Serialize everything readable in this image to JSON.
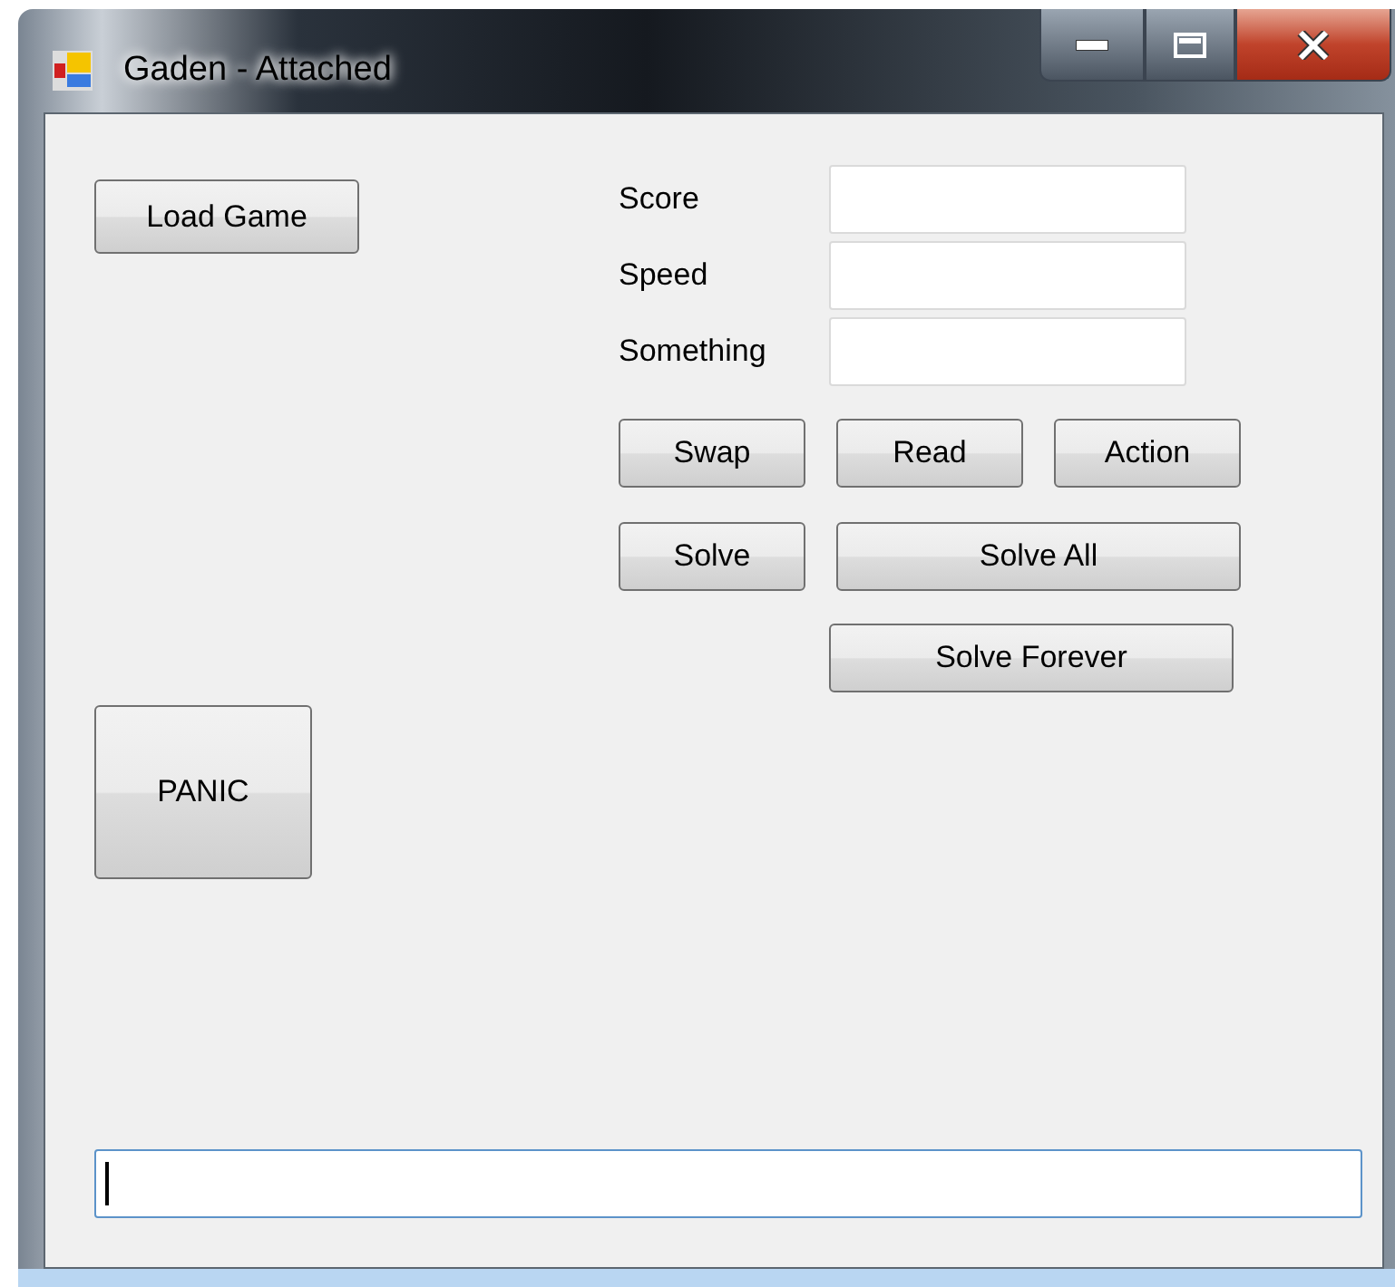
{
  "window": {
    "title": "Gaden - Attached"
  },
  "load_button": "Load Game",
  "fields": [
    {
      "label": "Score"
    },
    {
      "label": "Speed"
    },
    {
      "label": "Something"
    }
  ],
  "button_rows": [
    {
      "buttons": [
        {
          "label": "Swap"
        },
        {
          "label": "Read"
        },
        {
          "label": "Action"
        }
      ]
    },
    {
      "buttons": [
        {
          "label": "Solve"
        },
        {
          "label": "Solve All"
        }
      ]
    },
    {
      "buttons": [
        {
          "label": "Solve Forever"
        }
      ]
    }
  ],
  "panic_button": "PANIC",
  "log_field": {
    "focused": true
  }
}
